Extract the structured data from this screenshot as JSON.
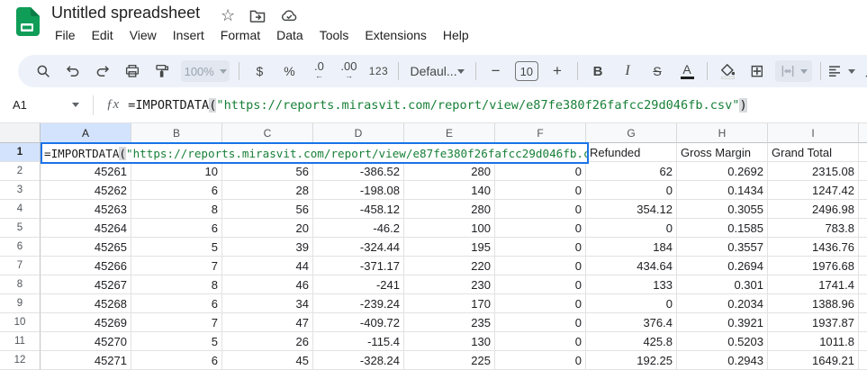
{
  "colors": {
    "accent_blue": "#1a73e8",
    "selection_header_blue": "#d3e3fd",
    "logo_green": "#0f9d58",
    "toolbar_bg": "#edf2fa",
    "formula_string_green": "#188038"
  },
  "titlebar": {
    "doc_title": "Untitled spreadsheet",
    "star_glyph": "☆"
  },
  "menu": {
    "items": [
      "File",
      "Edit",
      "View",
      "Insert",
      "Format",
      "Data",
      "Tools",
      "Extensions",
      "Help"
    ]
  },
  "toolbar": {
    "zoom_value": "100%",
    "currency": "$",
    "percent": "%",
    "decrease_decimal": ".0",
    "decrease_decimal_arrow": "←",
    "increase_decimal": ".00",
    "increase_decimal_arrow": "→",
    "number_format": "123",
    "font_name": "Defaul...",
    "decrease_font_size": "−",
    "font_size": "10",
    "increase_font_size": "+",
    "bold": "B",
    "italic": "I",
    "strikethrough": "S",
    "text_color": "A",
    "borders_glyph": "⊞"
  },
  "formula_bar": {
    "cell_ref": "A1",
    "fx_glyph": "ƒx",
    "formula": {
      "func": "=IMPORTDATA",
      "open_paren": "(",
      "string": "\"https://reports.mirasvit.com/report/view/e87fe380f26fafcc29d046fb.csv\"",
      "close_paren": ")"
    }
  },
  "grid": {
    "column_headers": [
      "A",
      "B",
      "C",
      "D",
      "E",
      "F",
      "G",
      "H",
      "I"
    ],
    "selected_column": "A",
    "row1": {
      "number": "1",
      "g": "Refunded",
      "h": "Gross Margin",
      "i": "Grand Total"
    },
    "data_rows": [
      {
        "n": "2",
        "cells": [
          "45261",
          "10",
          "56",
          "-386.52",
          "280",
          "0",
          "62",
          "0.2692",
          "2315.08"
        ]
      },
      {
        "n": "3",
        "cells": [
          "45262",
          "6",
          "28",
          "-198.08",
          "140",
          "0",
          "0",
          "0.1434",
          "1247.42"
        ]
      },
      {
        "n": "4",
        "cells": [
          "45263",
          "8",
          "56",
          "-458.12",
          "280",
          "0",
          "354.12",
          "0.3055",
          "2496.98"
        ]
      },
      {
        "n": "5",
        "cells": [
          "45264",
          "6",
          "20",
          "-46.2",
          "100",
          "0",
          "0",
          "0.1585",
          "783.8"
        ]
      },
      {
        "n": "6",
        "cells": [
          "45265",
          "5",
          "39",
          "-324.44",
          "195",
          "0",
          "184",
          "0.3557",
          "1436.76"
        ]
      },
      {
        "n": "7",
        "cells": [
          "45266",
          "7",
          "44",
          "-371.17",
          "220",
          "0",
          "434.64",
          "0.2694",
          "1976.68"
        ]
      },
      {
        "n": "8",
        "cells": [
          "45267",
          "8",
          "46",
          "-241",
          "230",
          "0",
          "133",
          "0.301",
          "1741.4"
        ]
      },
      {
        "n": "9",
        "cells": [
          "45268",
          "6",
          "34",
          "-239.24",
          "170",
          "0",
          "0",
          "0.2034",
          "1388.96"
        ]
      },
      {
        "n": "10",
        "cells": [
          "45269",
          "7",
          "47",
          "-409.72",
          "235",
          "0",
          "376.4",
          "0.3921",
          "1937.87"
        ]
      },
      {
        "n": "11",
        "cells": [
          "45270",
          "5",
          "26",
          "-115.4",
          "130",
          "0",
          "425.8",
          "0.5203",
          "1011.8"
        ]
      },
      {
        "n": "12",
        "cells": [
          "45271",
          "6",
          "45",
          "-328.24",
          "225",
          "0",
          "192.25",
          "0.2943",
          "1649.21"
        ]
      }
    ]
  }
}
